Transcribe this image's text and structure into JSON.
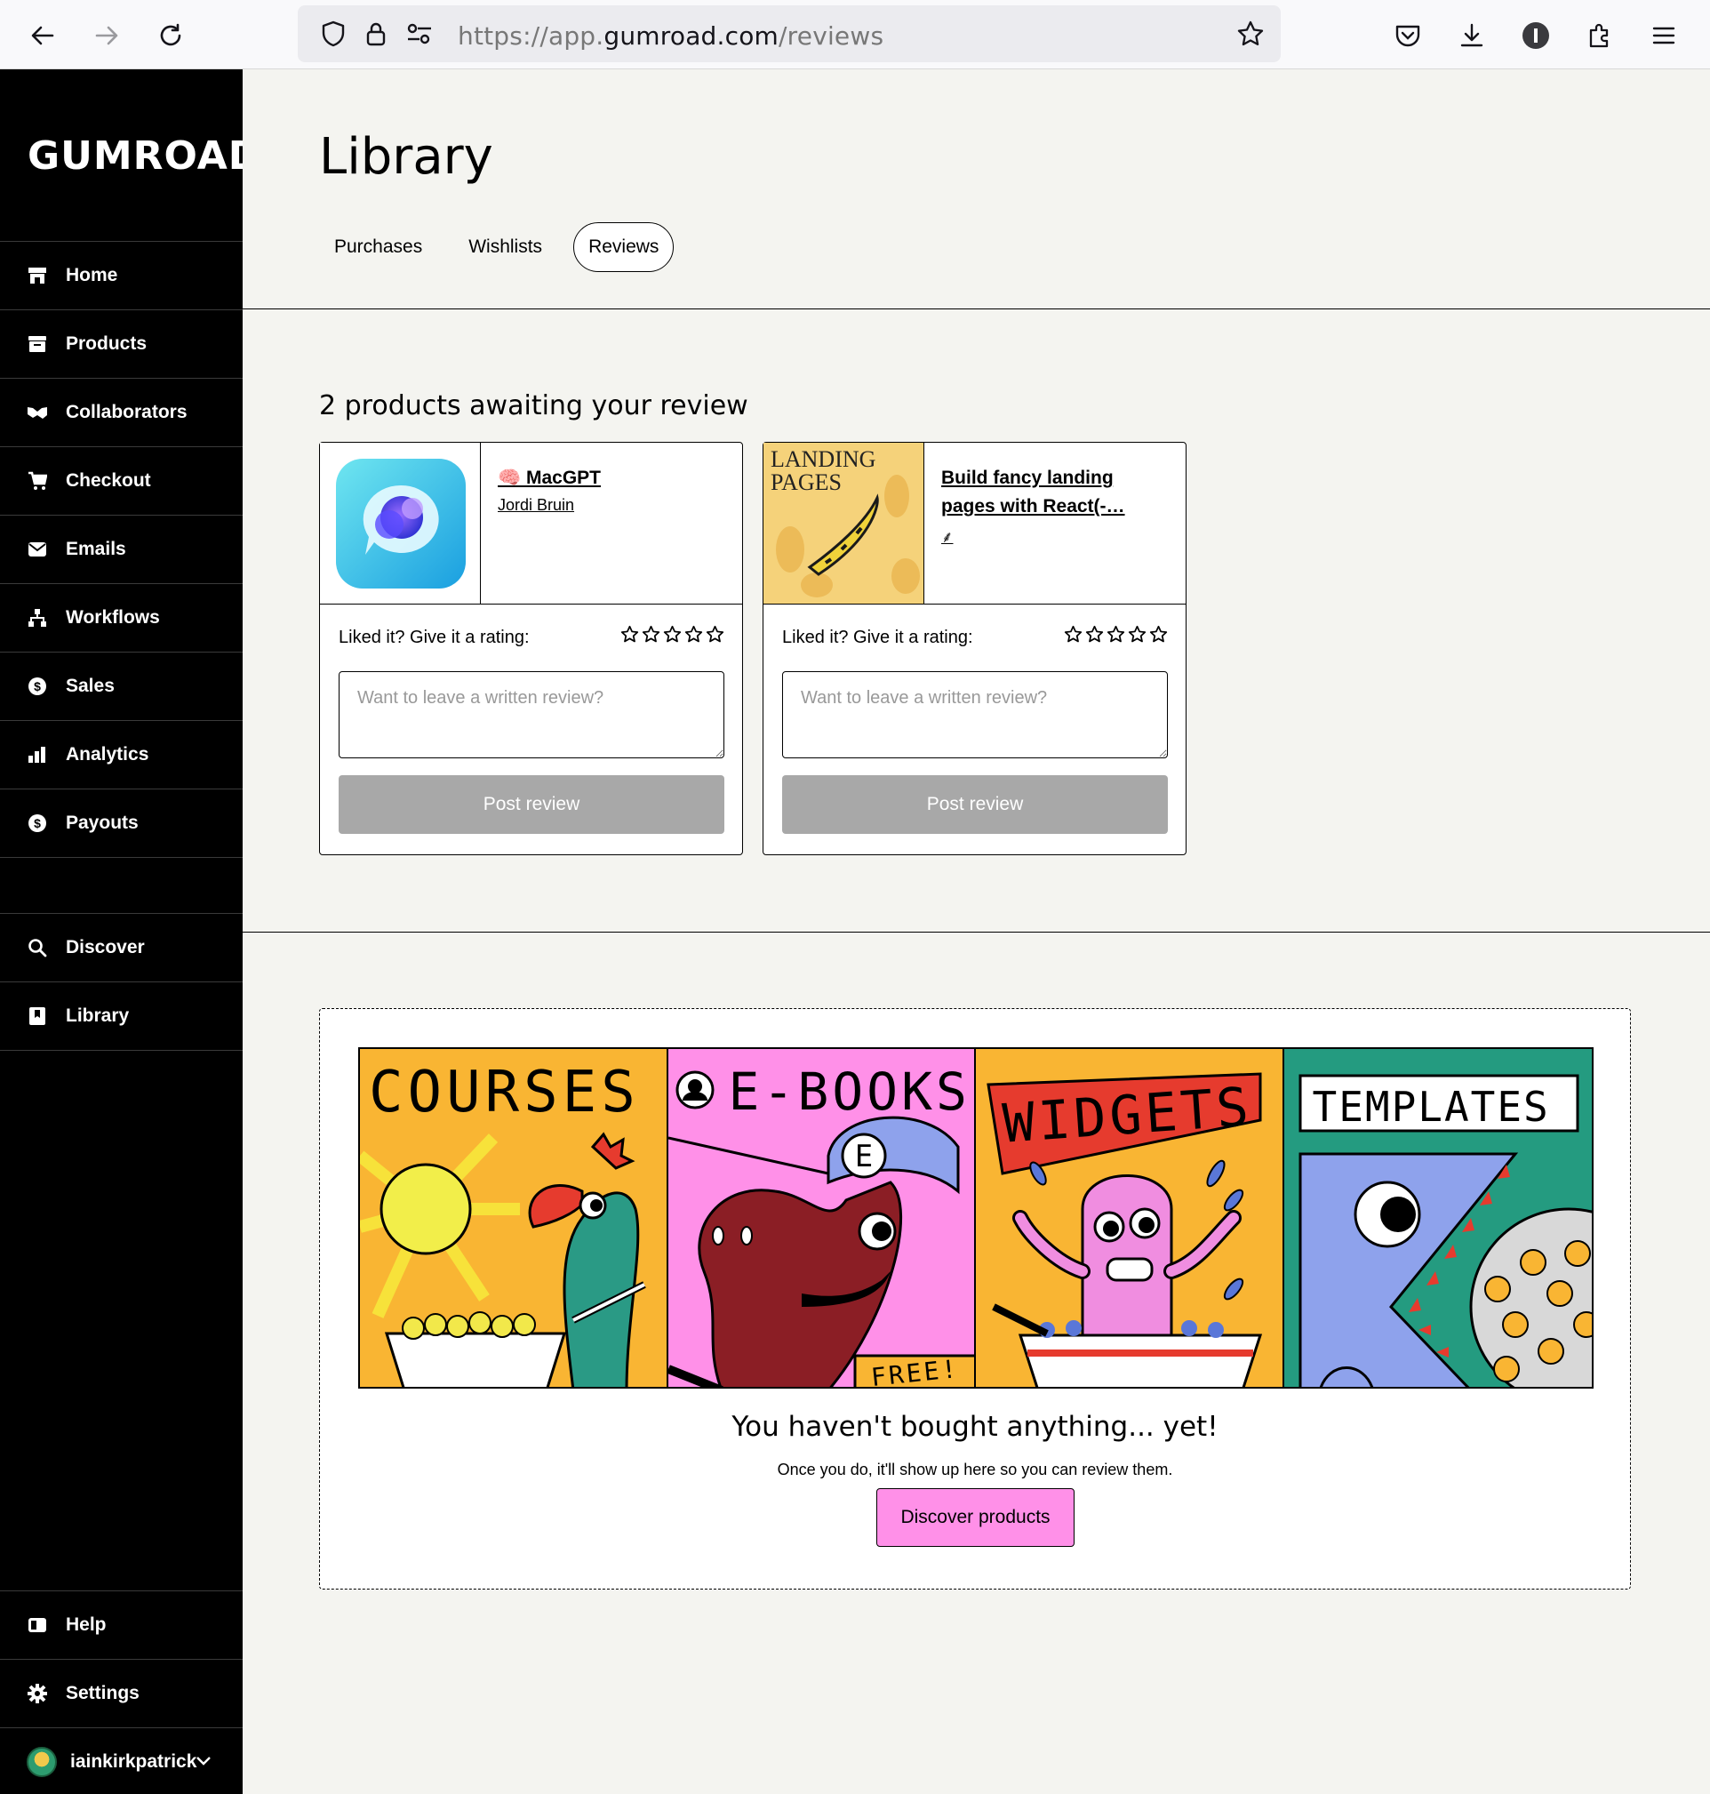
{
  "browser": {
    "url_prefix": "https://app.",
    "url_domain": "gumroad.com",
    "url_path": "/reviews"
  },
  "sidebar": {
    "logo": "GUMROAD",
    "items": [
      {
        "label": "Home",
        "icon": "store-icon"
      },
      {
        "label": "Products",
        "icon": "archive-icon"
      },
      {
        "label": "Collaborators",
        "icon": "handshake-icon"
      },
      {
        "label": "Checkout",
        "icon": "cart-icon"
      },
      {
        "label": "Emails",
        "icon": "envelope-icon"
      },
      {
        "label": "Workflows",
        "icon": "workflow-icon"
      },
      {
        "label": "Sales",
        "icon": "dollar-circle-icon"
      },
      {
        "label": "Analytics",
        "icon": "bar-chart-icon"
      },
      {
        "label": "Payouts",
        "icon": "dollar-circle-icon"
      }
    ],
    "secondary": [
      {
        "label": "Discover",
        "icon": "search-icon"
      },
      {
        "label": "Library",
        "icon": "bookmark-icon"
      }
    ],
    "bottom": [
      {
        "label": "Help",
        "icon": "book-icon"
      },
      {
        "label": "Settings",
        "icon": "gear-icon"
      }
    ],
    "user": "iainkirkpatrick"
  },
  "main": {
    "title": "Library",
    "tabs": [
      {
        "label": "Purchases",
        "active": false
      },
      {
        "label": "Wishlists",
        "active": false
      },
      {
        "label": "Reviews",
        "active": true
      }
    ],
    "section_title": "2 products awaiting your review",
    "cards": [
      {
        "name": "🧠 MacGPT",
        "creator": "Jordi Bruin",
        "rating_label": "Liked it? Give it a rating:",
        "placeholder": "Want to leave a written review?",
        "post_label": "Post review",
        "rating": 0
      },
      {
        "name": "Build fancy landing pages with React(-…",
        "creator": "⸙",
        "rating_label": "Liked it? Give it a rating:",
        "placeholder": "Want to leave a written review?",
        "post_label": "Post review",
        "rating": 0
      }
    ],
    "empty": {
      "panels": [
        "COURSES",
        "E-BOOKS",
        "WIDGETS",
        "TEMPLATES"
      ],
      "free_tag": "FREE!",
      "title": "You haven't bought anything... yet!",
      "subtitle": "Once you do, it'll show up here so you can review them.",
      "button": "Discover products"
    },
    "thumb2_text": "LANDING PAGES"
  },
  "colors": {
    "accent_pink": "#ff90e8",
    "sidebar_bg": "#000000",
    "main_bg": "#f4f4f0",
    "disabled_btn": "#a8a8a8"
  }
}
